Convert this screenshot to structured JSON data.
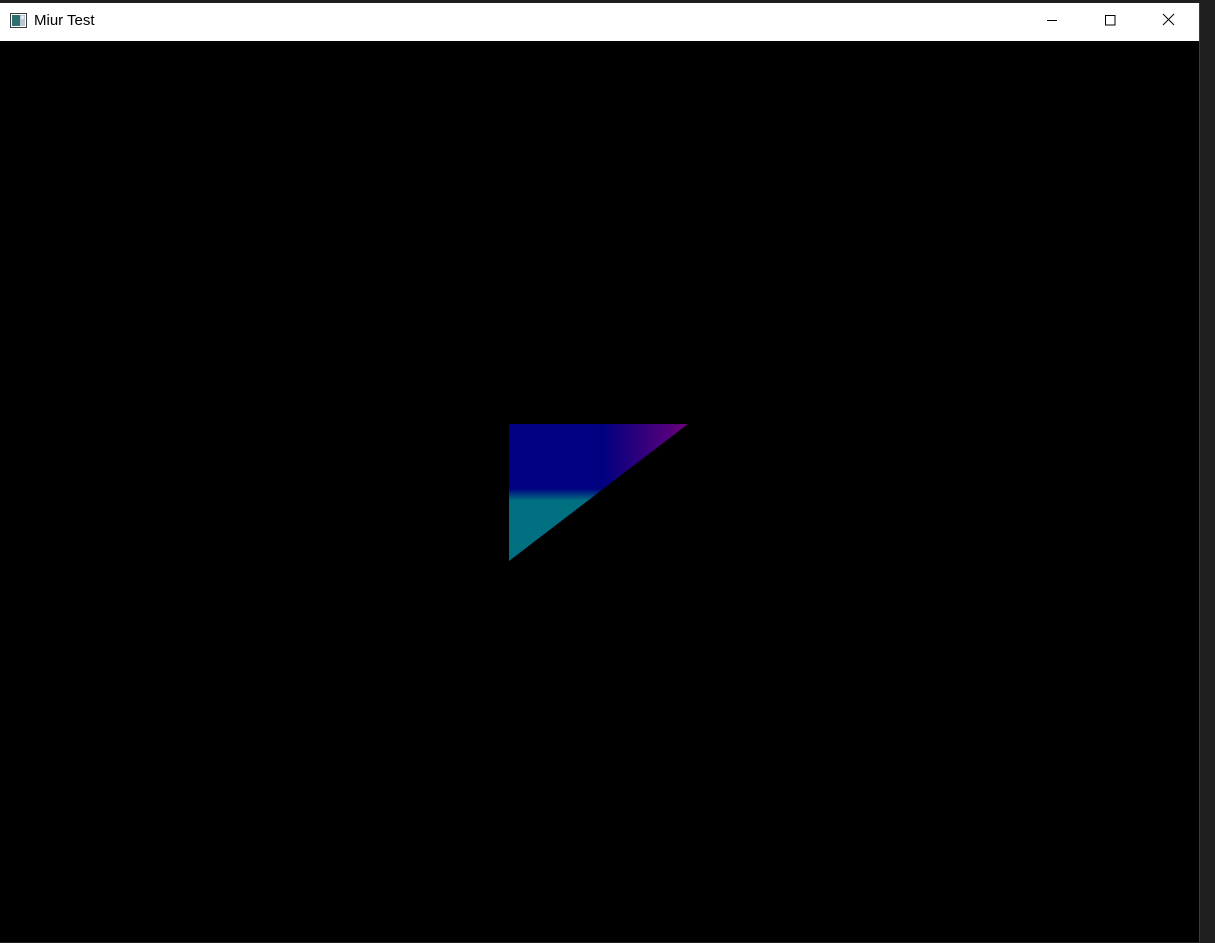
{
  "window": {
    "title": "Miur Test",
    "app_icon": "window-app-icon",
    "controls": {
      "minimize_icon": "minimize-icon",
      "maximize_icon": "maximize-icon",
      "close_icon": "close-icon"
    }
  },
  "viewport": {
    "background_color": "#000000",
    "triangle": {
      "colors": {
        "top_left": "#000080",
        "top_right": "#6a007a",
        "bottom_left": "#007080"
      }
    }
  }
}
